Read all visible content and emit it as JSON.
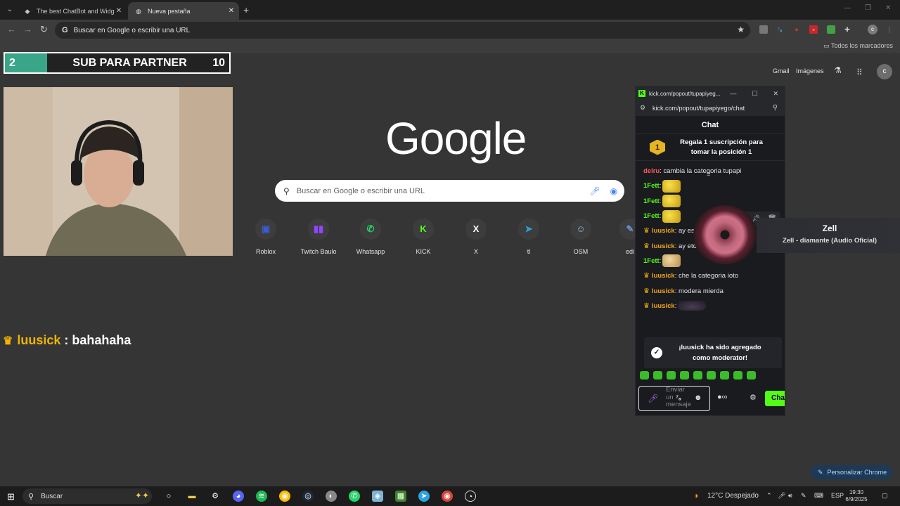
{
  "tabs": [
    {
      "title": "The best ChatBot and Widgets",
      "icon": "diamond-icon"
    },
    {
      "title": "Nueva pestaña",
      "icon": "chrome-icon"
    }
  ],
  "omnibox": {
    "placeholder": "Buscar en Google o escribir una URL"
  },
  "bookmarks": {
    "all_label": "Todos los marcadores"
  },
  "ntp": {
    "gmail": "Gmail",
    "images": "Imágenes",
    "avatar": "c",
    "logo": "Google",
    "search_placeholder": "Buscar en Google o escribir una URL",
    "shortcuts": [
      {
        "label": "Roblox",
        "icon": "roblox-icon",
        "glyph": "▣",
        "color": "#3b5ccf"
      },
      {
        "label": "Twitch Baulo",
        "icon": "twitch-icon",
        "glyph": "▮▮",
        "color": "#9146ff"
      },
      {
        "label": "Whatsapp",
        "icon": "whatsapp-icon",
        "glyph": "✆",
        "color": "#25d366"
      },
      {
        "label": "KICK",
        "icon": "kick-icon",
        "glyph": "K",
        "color": "#53fc18"
      },
      {
        "label": "X",
        "icon": "x-icon",
        "glyph": "X",
        "color": "#ffffff"
      },
      {
        "label": "tl",
        "icon": "telegram-icon",
        "glyph": "➤",
        "color": "#2aa3e0"
      },
      {
        "label": "OSM",
        "icon": "osm-icon",
        "glyph": "☺",
        "color": "#8fb6d8"
      },
      {
        "label": "edi",
        "icon": "edit-icon",
        "glyph": "✎",
        "color": "#6c8cd5"
      }
    ],
    "customize_label": "Personalizar Chrome"
  },
  "overlay": {
    "partner_left": "2",
    "partner_title": "SUB PARA PARTNER",
    "partner_right": "10",
    "msg_user": "luusick",
    "msg_sep": ":",
    "msg_text": "bahahaha"
  },
  "popup": {
    "window_title": "kick.com/popout/tupapiyeg...",
    "url": "kick.com/popout/tupapiyego/chat",
    "chat_title": "Chat",
    "sub_rank": "1",
    "sub_text": "Regala 1 suscripción para tomar la posición 1",
    "messages": [
      {
        "user": "delru",
        "text": ": cambia la categoria tupapi",
        "crown": false,
        "color": "red"
      },
      {
        "user": "1Fett",
        "text": ":",
        "crown": false,
        "color": "green",
        "emote": "yellow"
      },
      {
        "user": "1Fett",
        "text": ":",
        "crown": false,
        "color": "green",
        "emote": "yellow"
      },
      {
        "user": "1Fett",
        "text": ":",
        "crown": false,
        "color": "green",
        "emote": "yellow"
      },
      {
        "user": "luusick",
        "text": ": ay es",
        "crown": true,
        "color": "orange"
      },
      {
        "user": "luusick",
        "text": ": ay eto no me guta",
        "crown": true,
        "color": "orange",
        "emote": "brown"
      },
      {
        "user": "1Fett",
        "text": ":",
        "crown": false,
        "color": "green",
        "emote": "tan"
      },
      {
        "user": "luusick",
        "text": ": che la categoria ioto",
        "crown": true,
        "color": "orange"
      },
      {
        "user": "luusick",
        "text": ": modera mierda",
        "crown": true,
        "color": "orange"
      },
      {
        "user": "luusick",
        "text": ":",
        "crown": true,
        "color": "orange",
        "emote": "dark"
      }
    ],
    "toast": "¡luusick ha sido agregado como moderator!",
    "input_placeholder": "Enviar un mensaje",
    "chat_button": "Cha"
  },
  "now_playing": {
    "title": "Zell",
    "subtitle": "Zell - diamante (Audio Oficial)"
  },
  "taskbar": {
    "search": "Buscar",
    "weather": "12°C  Despejado",
    "lang": "ESP",
    "time": "19:30",
    "date": "6/9/2025"
  }
}
